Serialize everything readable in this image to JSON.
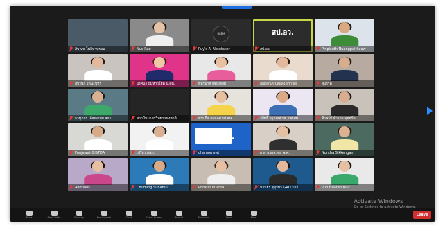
{
  "meeting": {
    "participants": [
      {
        "name": "ภิษณพ โพธิบาทรอน",
        "style": "plain",
        "bg": "#4a5a66"
      },
      {
        "name": "Nuc Ruo",
        "style": "person",
        "bg": "#8a8a8a",
        "skin": "#e5c3a9",
        "hair": "#2a1a14",
        "shirt": "#efefef"
      },
      {
        "name": "Puy's AI Notetaker",
        "style": "logo",
        "bg": "#2b2b2b",
        "logo_text": "BLEM"
      },
      {
        "name": "สป.อว.",
        "style": "text",
        "bg": "#2c2c2c",
        "card_text": "สป.อว.",
        "speaking": true
      },
      {
        "name": "Pinpisuth Nuangpairkaew",
        "style": "person",
        "bg": "#dde3ea",
        "skin": "#d9a982",
        "hair": "#1c1c1c",
        "shirt": "#3d8c3a"
      },
      {
        "name": "สุปรินกิ รัตนะบุทร",
        "style": "person",
        "bg": "#c9c4bf",
        "skin": "#e2b99c",
        "hair": "#2a1a14",
        "shirt": "#ffffff"
      },
      {
        "name": "ปริศนา ยมหาวิโยติ บ.คห.",
        "style": "person",
        "bg": "#e0348a",
        "skin": "#f0c8a8",
        "hair": "#3a2418",
        "shirt": "#1f2b6a"
      },
      {
        "name": "พัทรมาศ เพรียสุลิศ",
        "style": "person",
        "bg": "#e8e8e8",
        "skin": "#e8c0a0",
        "hair": "#1d1410",
        "shirt": "#e85d9b"
      },
      {
        "name": "อัญรัตนต ปัลแสง สราชด",
        "style": "person",
        "bg": "#e9dccf",
        "skin": "#e2b99c",
        "hair": "#2a1a14",
        "shirt": "#ffffff"
      },
      {
        "name": "สุบรีรีดิ",
        "style": "person",
        "bg": "#b7aaa0",
        "skin": "#d8ad8e",
        "hair": "#1a1a1a",
        "shirt": "#23324f"
      },
      {
        "name": "ธาทุภกร. อัศทอเทย สกว...",
        "style": "person",
        "bg": "#5a7a86",
        "skin": "#d9b092",
        "hair": "#1a1a1a",
        "shirt": "#3da86a"
      },
      {
        "name": "สถาบันมาตรวิทยาแห่งชาติ ...",
        "style": "plain",
        "bg": "#252525"
      },
      {
        "name": "พรนภิส ตรมอศ รศ.ศษ.",
        "style": "person",
        "bg": "#e6e2dc",
        "skin": "#e6bfa1",
        "hair": "#2a1a14",
        "shirt": "#f5d34a"
      },
      {
        "name": "วสิทธิ์ อรุณยศ รศ. กศ.ศษ.",
        "style": "person",
        "bg": "#ece6f2",
        "skin": "#d8aa88",
        "hair": "#1a1a1a",
        "shirt": "#3c6fb4"
      },
      {
        "name": "ศิวพร์ม์ ตัวรวด อุตตรัต...",
        "style": "person",
        "bg": "#c9c2ba",
        "skin": "#d9ae90",
        "hair": "#1a1a1a",
        "shirt": "#2b2b2b"
      },
      {
        "name": "Punjawat GISTDA",
        "style": "person",
        "bg": "#d8d8d4",
        "skin": "#d8aa88",
        "hair": "#1a1a1a",
        "shirt": "#ffffff"
      },
      {
        "name": "เปรียว สพภ.",
        "style": "person",
        "bg": "#f2f2f2",
        "skin": "#d9b092",
        "hair": "#1a1a1a",
        "shirt": "#ffffff"
      },
      {
        "name": "chamon swt",
        "style": "slide",
        "bg": "#1e64c8",
        "card_text": "MSC."
      },
      {
        "name": "ดวง อบผล.สอ. พ.ศ.",
        "style": "person",
        "bg": "#d8d0c6",
        "skin": "#e6c0a2",
        "hair": "#2a1a14",
        "shirt": "#2f2f2f"
      },
      {
        "name": "Nontha Sikkengam",
        "style": "person",
        "bg": "#4d6a60",
        "skin": "#dcb292",
        "hair": "#2a1a14",
        "shirt": "#f0e6a8"
      },
      {
        "name": "Addtions ...",
        "style": "person",
        "bg": "#b9a9c9",
        "skin": "#e6c0a2",
        "hair": "#1d1410",
        "shirt": "#c9478a"
      },
      {
        "name": "Chuming Suhamu",
        "style": "person",
        "bg": "#2d7ab9",
        "skin": "#d8aa88",
        "hair": "#1a1a1a",
        "shirt": "#ffffff"
      },
      {
        "name": "Phrarat Puanta",
        "style": "person",
        "bg": "#c7bdb2",
        "skin": "#e6c0a2",
        "hair": "#3a2418",
        "shirt": "#efefef"
      },
      {
        "name": "นามยุริ สุทุริพา GRO มายี...",
        "style": "person",
        "bg": "#1f5a8e",
        "skin": "#e2b99c",
        "hair": "#1d1410",
        "shirt": "#2b2b2b"
      },
      {
        "name": "Pup Huaran Biut",
        "style": "person",
        "bg": "#e9e9ea",
        "skin": "#e6c0a2",
        "hair": "#1a1a1a",
        "shirt": "#3aa86a"
      }
    ]
  },
  "toolbar": {
    "buttons": [
      {
        "label": "Mute",
        "icon": "microphone-icon"
      },
      {
        "label": "Stop Video",
        "icon": "video-camera-icon"
      },
      {
        "label": "Security",
        "icon": "shield-icon"
      },
      {
        "label": "Participants",
        "icon": "participants-icon"
      },
      {
        "label": "Chat",
        "icon": "chat-icon"
      },
      {
        "label": "Share Screen",
        "icon": "share-screen-icon"
      },
      {
        "label": "Record",
        "icon": "record-icon"
      },
      {
        "label": "Reactions",
        "icon": "reactions-icon"
      },
      {
        "label": "Apps",
        "icon": "apps-icon"
      },
      {
        "label": "More",
        "icon": "more-icon"
      }
    ],
    "leave_label": "Leave"
  },
  "watermark": {
    "title": "Activate Windows",
    "subtitle": "Go to Settings to activate Windows."
  },
  "colors": {
    "accent": "#2d8cff",
    "leave": "#d22f2f",
    "speaking_outline": "#c8d64a"
  }
}
